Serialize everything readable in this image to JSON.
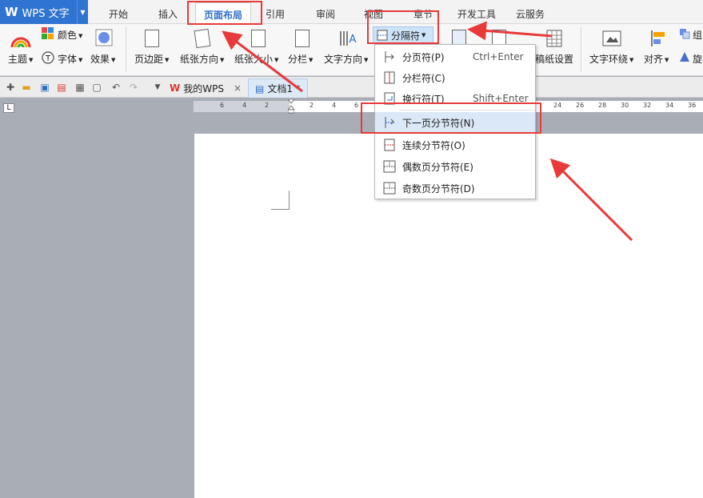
{
  "app": {
    "logo": "W",
    "title": "WPS 文字"
  },
  "tabs": [
    {
      "label": "开始"
    },
    {
      "label": "插入"
    },
    {
      "label": "页面布局"
    },
    {
      "label": "引用"
    },
    {
      "label": "审阅"
    },
    {
      "label": "视图"
    },
    {
      "label": "章节"
    },
    {
      "label": "开发工具"
    },
    {
      "label": "云服务"
    }
  ],
  "ribbon": {
    "color": "颜色",
    "theme": "主题",
    "font": "字体",
    "effect": "效果",
    "margins": "页边距",
    "orientation": "纸张方向",
    "size": "纸张大小",
    "columns": "分栏",
    "text_direction": "文字方向",
    "separator": "分隔符",
    "manuscript": "稿纸设置",
    "wrap": "文字环绕",
    "align": "对齐",
    "group": "组",
    "rotate": "旋"
  },
  "doc_tabs": {
    "home": "我的WPS",
    "doc": "文档1 *"
  },
  "ruler": {
    "ticks": [
      "6",
      "4",
      "2",
      "",
      "2",
      "4",
      "6",
      "24",
      "26",
      "28",
      "30",
      "32",
      "34",
      "36"
    ]
  },
  "menu": {
    "items": [
      {
        "label": "分页符(P)",
        "shortcut": "Ctrl+Enter"
      },
      {
        "label": "分栏符(C)",
        "shortcut": ""
      },
      {
        "label": "换行符(T)",
        "shortcut": "Shift+Enter"
      },
      {
        "label": "下一页分节符(N)",
        "shortcut": ""
      },
      {
        "label": "连续分节符(O)",
        "shortcut": ""
      },
      {
        "label": "偶数页分节符(E)",
        "shortcut": ""
      },
      {
        "label": "奇数页分节符(D)",
        "shortcut": ""
      }
    ]
  },
  "colors": {
    "accent": "#2f74d0",
    "annotation": "#e83a3a",
    "highlight": "#dbe8f7"
  }
}
